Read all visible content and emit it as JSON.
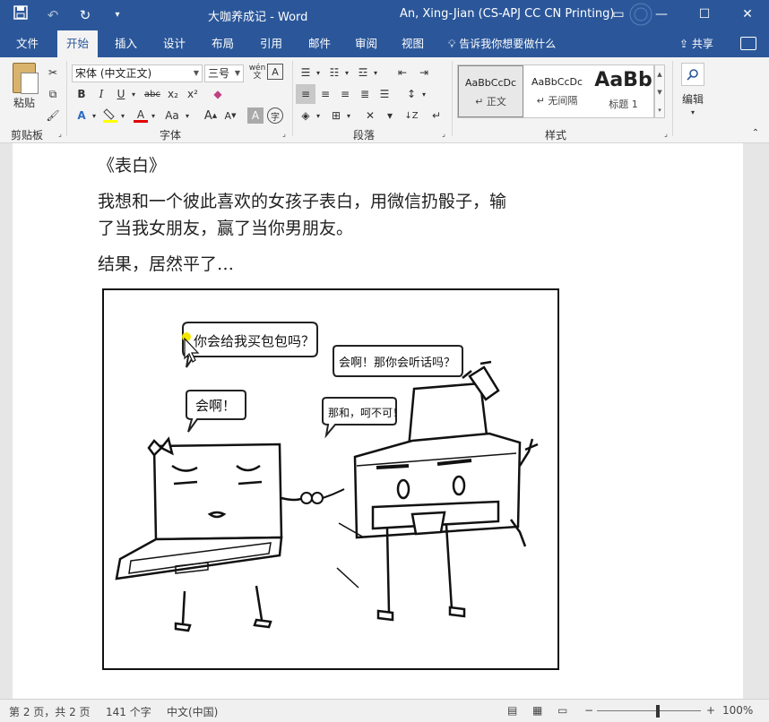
{
  "titlebar": {
    "doc_title": "大咖养成记",
    "sep": "-",
    "app": "Word",
    "user": "An, Xing-Jian (CS-APJ CC CN Printing)",
    "save_icon": "save-icon",
    "undo_icon": "undo-icon",
    "redo_icon": "redo-icon",
    "customize_icon": "customize-qat-icon",
    "minimize": "—",
    "restore": "☐",
    "close": "✕"
  },
  "tabs": [
    "文件",
    "开始",
    "插入",
    "设计",
    "布局",
    "引用",
    "邮件",
    "审阅",
    "视图"
  ],
  "tell_me": "告诉我你想要做什么",
  "share": "共享",
  "ribbon": {
    "clipboard": {
      "paste": "粘贴",
      "label": "剪贴板"
    },
    "font": {
      "font_name": "宋体 (中文正文)",
      "font_size": "三号",
      "label": "字体",
      "bold": "B",
      "italic": "I",
      "underline": "U",
      "strike": "abc",
      "subscript": "x₂",
      "superscript": "x²",
      "grow": "A",
      "shrink": "A",
      "case": "Aa",
      "phonetic": "wén",
      "enclose": "字"
    },
    "paragraph": {
      "label": "段落"
    },
    "styles": {
      "label": "样式",
      "items": [
        {
          "sample": "AaBbCcDc",
          "name": "↵ 正文"
        },
        {
          "sample": "AaBbCcDc",
          "name": "↵ 无间隔"
        },
        {
          "sample": "AaBb",
          "name": "标题 1"
        }
      ]
    },
    "editing": {
      "label": "编辑"
    }
  },
  "document": {
    "heading": "《表白》",
    "para1_line1": "我想和一个彼此喜欢的女孩子表白，用微信扔骰子，输",
    "para1_line2": "了当我女朋友，赢了当你男朋友。",
    "para2": "结果，居然平了…",
    "comic": {
      "bubble1": "你会给我买包包吗？",
      "bubble2": "会啊！",
      "bubble3": "会啊！那你会听话吗？",
      "bubble4": "那和，呵不可！"
    }
  },
  "status": {
    "page": "第 2 页，共 2 页",
    "words": "141 个字",
    "language": "中文(中国)",
    "zoom": "100%"
  },
  "colors": {
    "brand": "#2b579a",
    "ribbon_bg": "#f3f3f3",
    "highlight": "#ffff00",
    "font_color": "#e00000"
  }
}
